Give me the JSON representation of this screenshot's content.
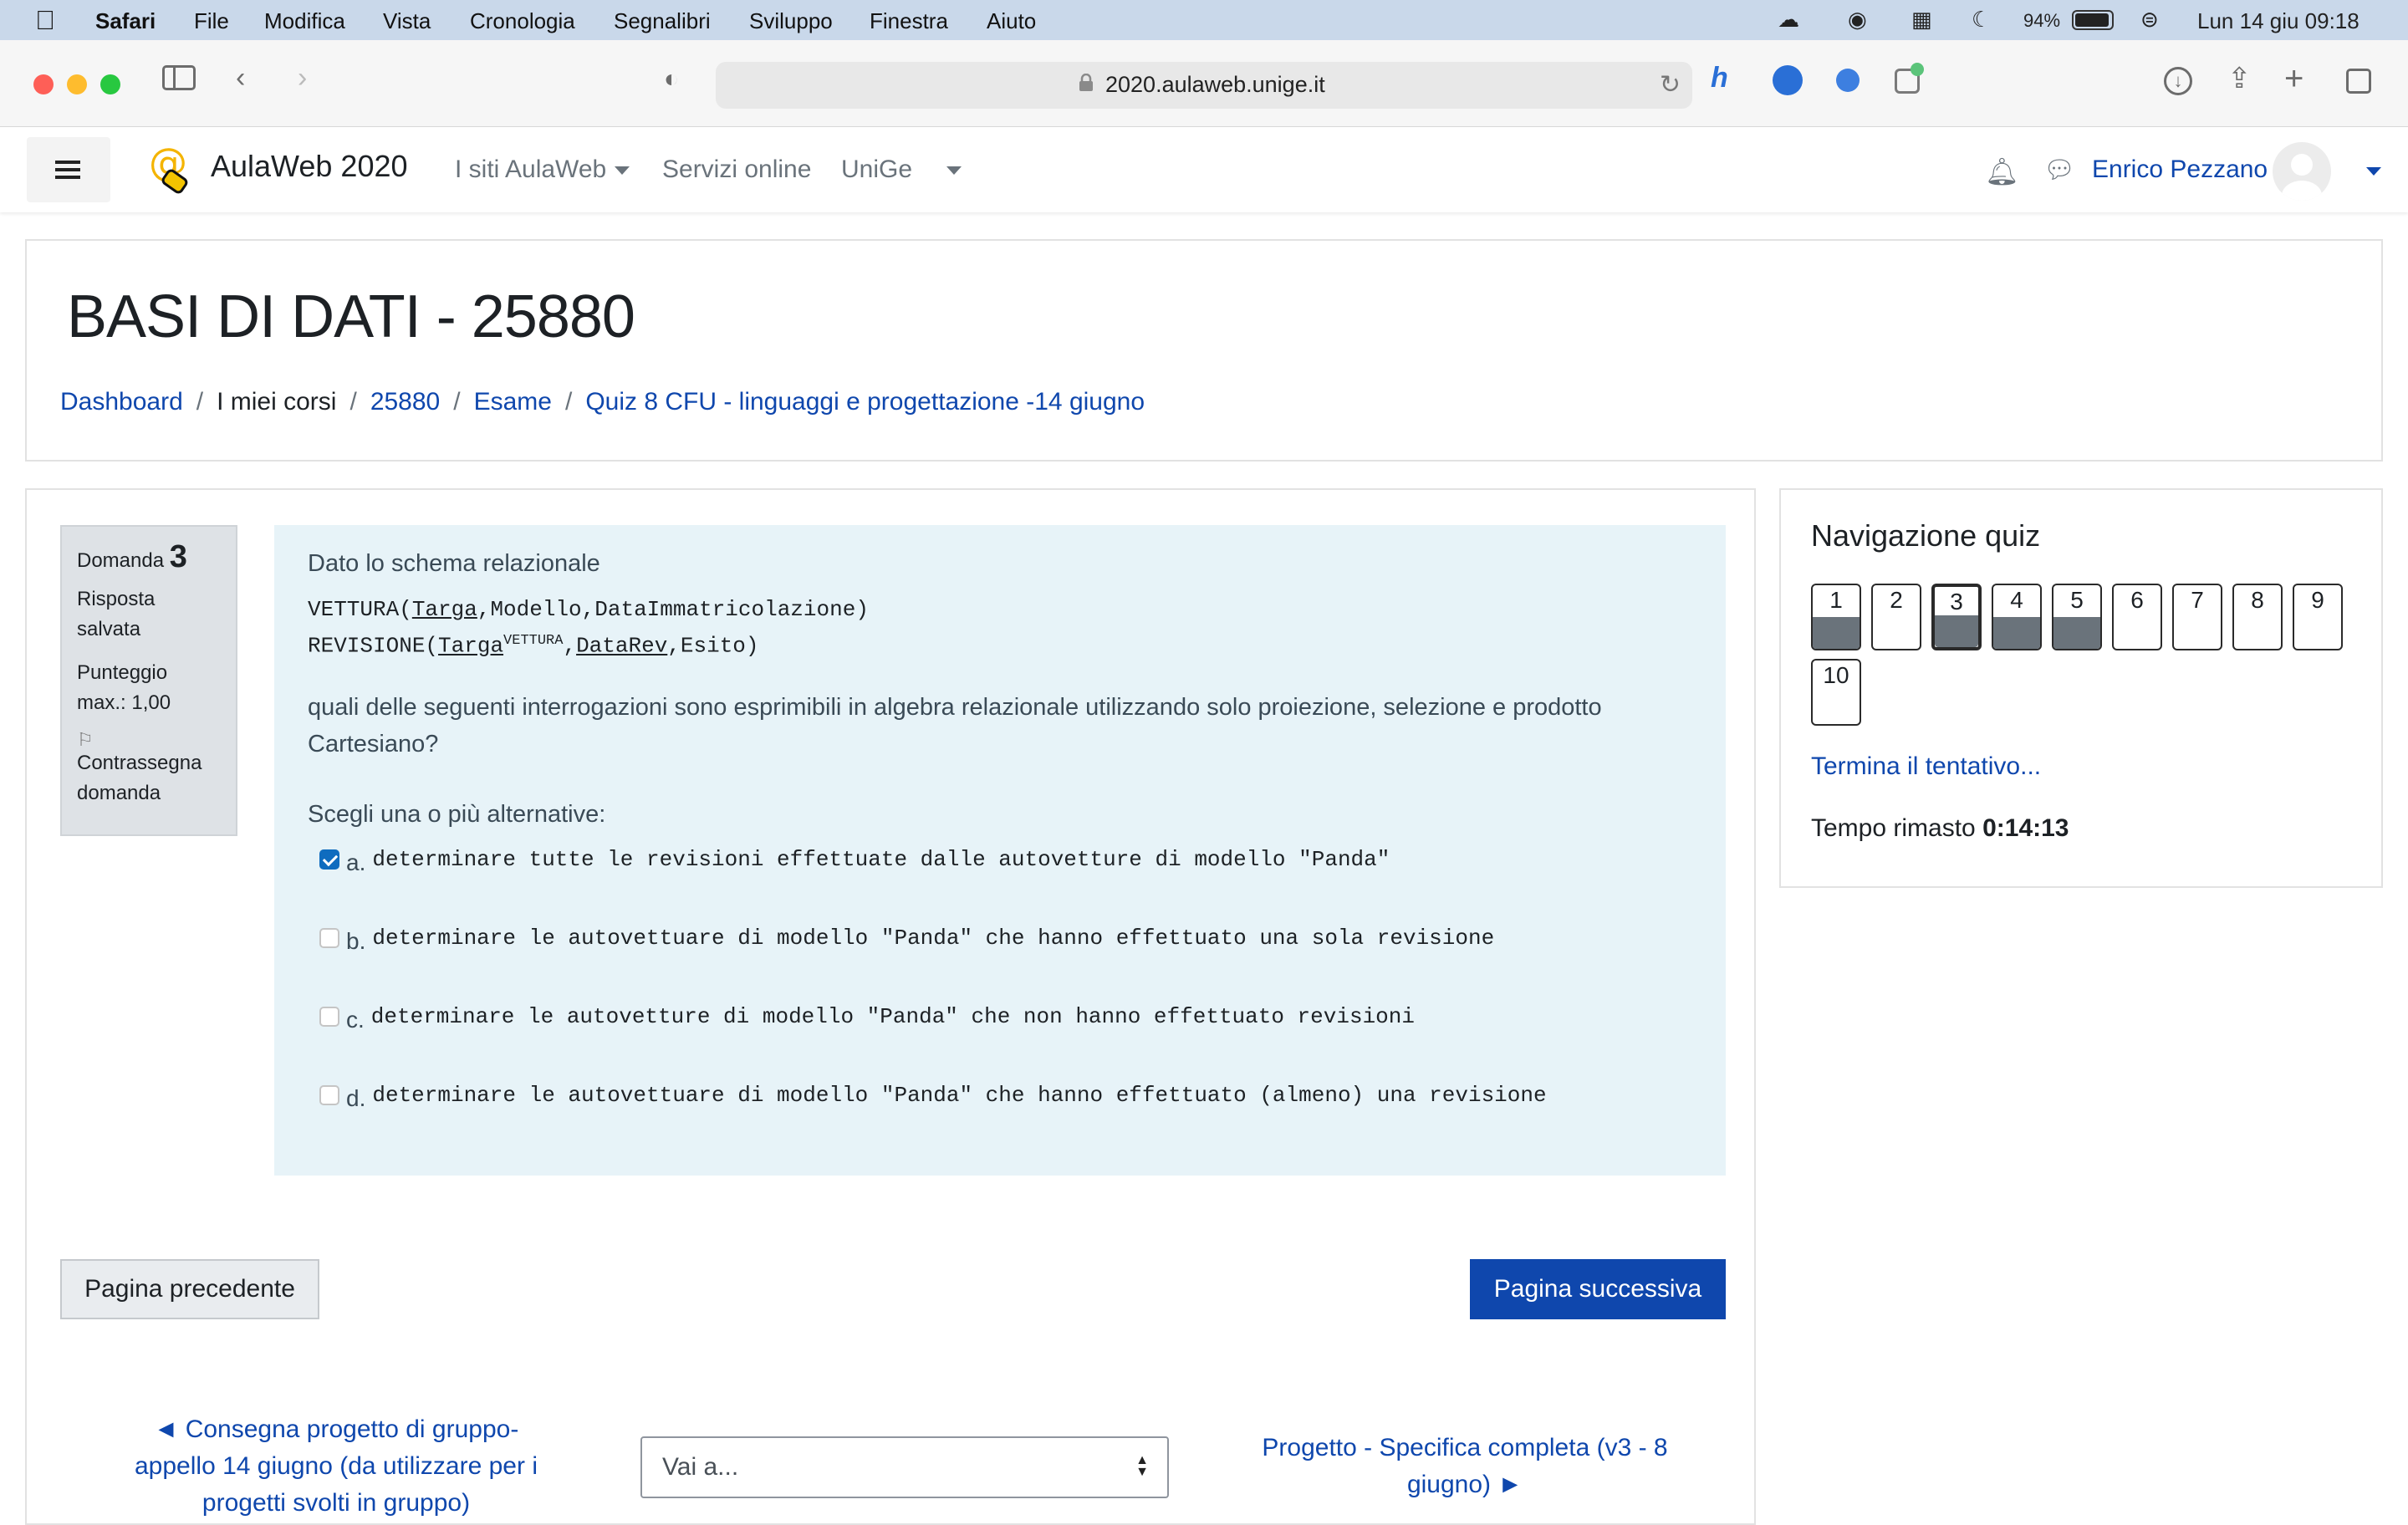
{
  "menubar": {
    "app": "Safari",
    "items": [
      "File",
      "Modifica",
      "Vista",
      "Cronologia",
      "Segnalibri",
      "Sviluppo",
      "Finestra",
      "Aiuto"
    ],
    "battery": "94%",
    "datetime": "Lun 14 giu  09:18"
  },
  "browser": {
    "url": "2020.aulaweb.unige.it"
  },
  "nav": {
    "site_name": "AulaWeb 2020",
    "links": [
      "I siti AulaWeb",
      "Servizi online",
      "UniGe"
    ],
    "user_name": "Enrico Pezzano"
  },
  "header": {
    "title": "BASI DI DATI - 25880",
    "breadcrumb": [
      "Dashboard",
      "I miei corsi",
      "25880",
      "Esame",
      "Quiz 8 CFU - linguaggi e progettazione -14 giugno"
    ]
  },
  "question_info": {
    "label": "Domanda",
    "number": "3",
    "status": "Risposta salvata",
    "score": "Punteggio max.: 1,00",
    "flag": "Contrassegna domanda"
  },
  "question": {
    "intro": "Dato lo schema relazionale",
    "schema": {
      "line1_rel": "VETTURA(",
      "line1_key": "Targa",
      "line1_rest": ",Modello,DataImmatricolazione)",
      "line2_rel": "REVISIONE(",
      "line2_key": "Targa",
      "line2_sup": "VETTURA",
      "line2_comma": ",",
      "line2_key2": "DataRev",
      "line2_rest": ",Esito)"
    },
    "text_line1": "quali delle seguenti interrogazioni sono esprimibili in algebra relazionale utilizzando solo proiezione, selezione e prodotto",
    "text_line2": "Cartesiano?",
    "prompt": "Scegli una o più alternative:",
    "options": [
      {
        "letter": "a.",
        "text": "determinare tutte le revisioni effettuate dalle autovetture di modello \"Panda\"",
        "checked": true
      },
      {
        "letter": "b.",
        "text": "determinare le autovettuare di modello \"Panda\" che hanno effettuato una sola revisione",
        "checked": false
      },
      {
        "letter": "c.",
        "text": "determinare le autovetture di modello \"Panda\" che non hanno effettuato revisioni",
        "checked": false
      },
      {
        "letter": "d.",
        "text": "determinare le autovettuare di modello \"Panda\" che hanno effettuato (almeno) una revisione",
        "checked": false
      }
    ]
  },
  "buttons": {
    "prev": "Pagina precedente",
    "next": "Pagina successiva"
  },
  "footer": {
    "prev_activity_l1": "◄ Consegna progetto di gruppo-",
    "prev_activity_l2": "appello 14 giugno (da utilizzare per i",
    "prev_activity_l3": "progetti svolti in gruppo)",
    "jump_placeholder": "Vai a...",
    "next_activity_l1": "Progetto - Specifica completa (v3 - 8",
    "next_activity_l2": "giugno) ►"
  },
  "quiz_nav": {
    "title": "Navigazione quiz",
    "questions": [
      {
        "n": "1",
        "answered": true
      },
      {
        "n": "2",
        "answered": false
      },
      {
        "n": "3",
        "answered": true,
        "current": true
      },
      {
        "n": "4",
        "answered": true
      },
      {
        "n": "5",
        "answered": true
      },
      {
        "n": "6",
        "answered": false
      },
      {
        "n": "7",
        "answered": false
      },
      {
        "n": "8",
        "answered": false
      },
      {
        "n": "9",
        "answered": false
      },
      {
        "n": "10",
        "answered": false
      }
    ],
    "finish": "Termina il tentativo...",
    "time_label": "Tempo rimasto",
    "time_value": "0:14:13"
  },
  "colors": {
    "accent": "#0f47ad",
    "question_bg": "#e7f3f8",
    "info_bg": "#dee2e6"
  }
}
